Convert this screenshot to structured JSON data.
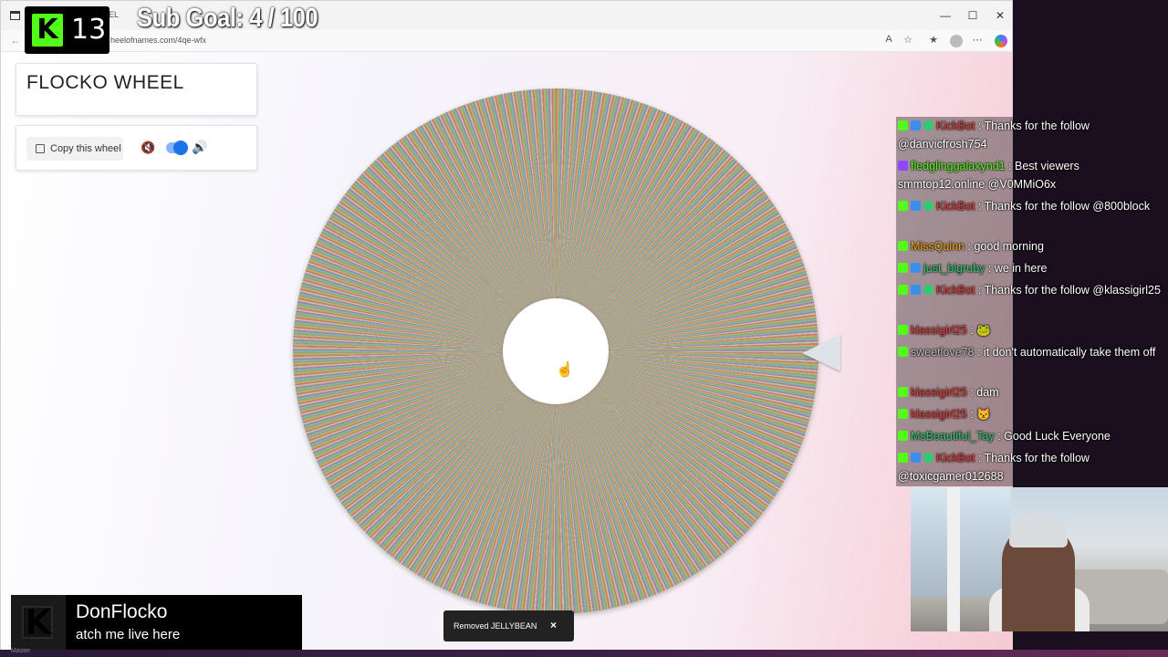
{
  "browser": {
    "tab_title": "EL",
    "url": "heelofnames.com/4qe-wfx",
    "back_icon": "back-arrow-icon",
    "controls": [
      "minimize-icon",
      "maximize-icon",
      "close-icon"
    ]
  },
  "wheel_app": {
    "title": "FLOCKO WHEEL",
    "copy_label": "Copy this wheel",
    "sound_toggle_on": true,
    "toast": "Removed JELLYBEAN",
    "toast_close": "×"
  },
  "overlay": {
    "kick_count": "13",
    "sub_goal": "Sub Goal:  4 / 100",
    "streamer_name": "DonFlocko",
    "streamer_sub": "atch me live here",
    "footer_tag": "Master"
  },
  "chat": [
    {
      "user": "KickBot",
      "user_color": "#e53935",
      "badges": [
        "bk",
        "bb",
        "bg"
      ],
      "text": "Thanks for the follow @danvicfrosh754"
    },
    {
      "user": "fledglinggalaxynd1",
      "user_color": "#53fc18",
      "badges": [
        "bt"
      ],
      "text": "Best viewers smmtop12.online @V0MMiO6x"
    },
    {
      "user": "KickBot",
      "user_color": "#e53935",
      "badges": [
        "bk",
        "bb",
        "bg"
      ],
      "text": "Thanks for the follow @800block"
    },
    {
      "user": "MissQuinn",
      "user_color": "#f0a500",
      "badges": [
        "bk"
      ],
      "text": "good morning"
    },
    {
      "user": "just_bigruby",
      "user_color": "#2ecc71",
      "badges": [
        "bk",
        "bb"
      ],
      "text": "we in here"
    },
    {
      "user": "KickBot",
      "user_color": "#e53935",
      "badges": [
        "bk",
        "bb",
        "bg"
      ],
      "text": "Thanks for the follow @klassigirl25"
    },
    {
      "user": "klassigirl25",
      "user_color": "#e53935",
      "badges": [
        "bk"
      ],
      "text": "🐸"
    },
    {
      "user": "sweetlove78",
      "user_color": "#bbbbbb",
      "badges": [
        "bk"
      ],
      "text": "it don't automatically take them off"
    },
    {
      "user": "klassigirl25",
      "user_color": "#e53935",
      "badges": [
        "bk"
      ],
      "text": "dam"
    },
    {
      "user": "klassigirl25",
      "user_color": "#e53935",
      "badges": [
        "bk"
      ],
      "text": "😾"
    },
    {
      "user": "MsBeautiful_Tay",
      "user_color": "#2ecc71",
      "badges": [
        "bk"
      ],
      "text": "Good Luck Everyone"
    },
    {
      "user": "KickBot",
      "user_color": "#e53935",
      "badges": [
        "bk",
        "bb",
        "bg"
      ],
      "text": "Thanks for the follow @toxicgamer012688"
    }
  ]
}
